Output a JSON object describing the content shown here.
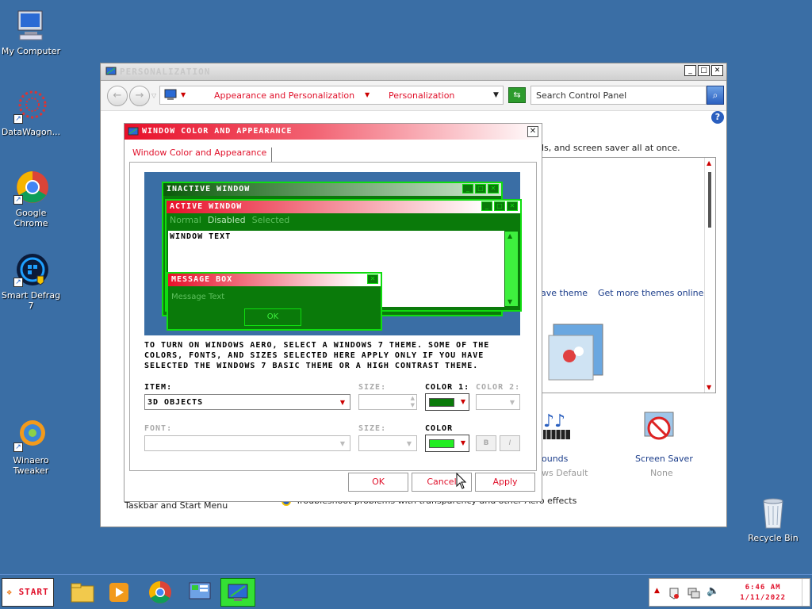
{
  "desktop": {
    "icons": [
      {
        "label": "My Computer"
      },
      {
        "label": "DataWagon..."
      },
      {
        "label": "Google Chrome"
      },
      {
        "label": "Smart Defrag 7"
      },
      {
        "label": "Winaero Tweaker"
      },
      {
        "label": "Recycle Bin"
      }
    ]
  },
  "main_window": {
    "title": "PERSONALIZATION",
    "breadcrumb": [
      "Appearance and Personalization",
      "Personalization"
    ],
    "search_placeholder": "Search Control Panel",
    "bg_text": {
      "themes_desc": "ds, and screen saver all at once.",
      "save_theme": "ave theme",
      "get_more": "Get more themes online",
      "sounds": "ounds",
      "sounds_sub": "ws Default",
      "screen_saver": "Screen Saver",
      "screen_saver_sub": "None",
      "taskbar": "Taskbar and Start Menu",
      "troubleshoot": "Troubleshoot problems with transparency and other Aero effects"
    }
  },
  "dialog": {
    "title": "WINDOW COLOR AND APPEARANCE",
    "tab": "Window Color and Appearance",
    "preview": {
      "inactive_title": "INACTIVE WINDOW",
      "active_title": "ACTIVE WINDOW",
      "menu": [
        "Normal",
        "Disabled",
        "Selected"
      ],
      "window_text": "WINDOW TEXT",
      "msg_title": "MESSAGE BOX",
      "msg_text": "Message Text",
      "ok": "OK"
    },
    "description": "TO TURN ON WINDOWS AERO, SELECT A WINDOWS 7 THEME. SOME OF THE COLORS, FONTS, AND SIZES SELECTED HERE APPLY ONLY IF YOU HAVE SELECTED THE WINDOWS 7 BASIC THEME OR A HIGH CONTRAST THEME.",
    "item_label": "ITEM:",
    "item_value": "3D OBJECTS",
    "size_label": "SIZE:",
    "color1_label": "COLOR 1:",
    "color2_label": "COLOR 2:",
    "font_label": "FONT:",
    "size2_label": "SIZE:",
    "color_label": "COLOR",
    "bold": "B",
    "italic": "I",
    "buttons": {
      "ok": "OK",
      "cancel": "Cancel",
      "apply": "Apply"
    },
    "colors": {
      "color1": "#0a7a0a",
      "font_color": "#22ee22"
    }
  },
  "taskbar": {
    "start": "START",
    "time": "6:46 AM",
    "date": "1/11/2022"
  }
}
